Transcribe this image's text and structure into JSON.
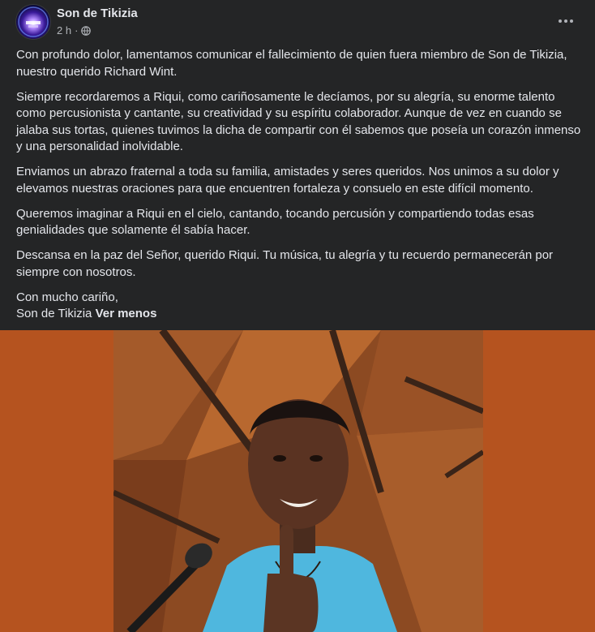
{
  "post": {
    "author": "Son de Tikizia",
    "time": "2 h",
    "separator": "·",
    "audience_icon": "globe-icon",
    "more_icon": "more-horizontal-icon",
    "paragraphs": [
      "Con profundo dolor, lamentamos comunicar el fallecimiento de quien fuera miembro de Son de Tikizia, nuestro querido Richard Wint.",
      "Siempre recordaremos a Riqui, como cariñosamente le decíamos, por su alegría, su enorme talento como percusionista y cantante, su creatividad y su espíritu colaborador. Aunque de vez en cuando se jalaba sus tortas, quienes tuvimos la dicha de compartir con él sabemos que poseía un corazón inmenso y una personalidad inolvidable.",
      "Enviamos un abrazo fraternal a toda su familia, amistades y seres queridos. Nos unimos a su dolor y elevamos nuestras oraciones para que encuentren fortaleza y consuelo en este difícil momento.",
      "Queremos imaginar a Riqui en el cielo, cantando, tocando percusión y compartiendo todas esas genialidades que solamente él sabía hacer.",
      "Descansa en la paz del Señor, querido Riqui. Tu música, tu alegría y tu recuerdo permanecerán por siempre con nosotros."
    ],
    "closing_line1": "Con mucho cariño,",
    "closing_line2": "Son de Tikizia",
    "see_less": "Ver menos"
  },
  "colors": {
    "background": "#242526",
    "text": "#e4e6eb",
    "secondary_text": "#b0b3b8",
    "photo_background": "#b5531f"
  }
}
